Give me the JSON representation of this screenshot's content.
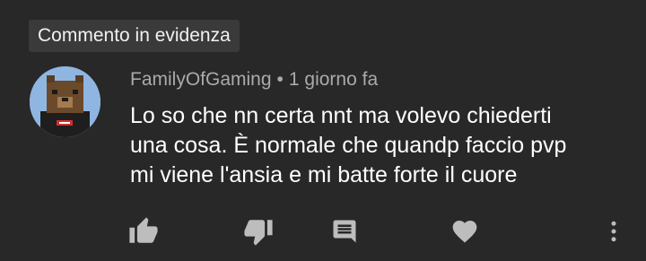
{
  "pinned_label": "Commento in evidenza",
  "comment": {
    "author": "FamilyOfGaming",
    "separator": "•",
    "time": "1 giorno fa",
    "text_lines": [
      "Lo so che nn certa nnt ma volevo chiederti",
      "una cosa. È normale che quandp faccio pvp",
      "mi viene l'ansia e mi batte forte il cuore"
    ]
  },
  "actions": [
    {
      "icon": "thumbs-up-icon"
    },
    {
      "icon": "thumbs-down-icon"
    },
    {
      "icon": "reply-icon"
    },
    {
      "icon": "heart-icon"
    },
    {
      "icon": "more-vert-icon"
    }
  ],
  "colors": {
    "background": "#282828",
    "badge_bg": "#3a3a3a",
    "text_primary": "#ffffff",
    "text_secondary": "#aaaaaa",
    "icon": "#bdbdbd",
    "avatar_bg": "#8fb6e0"
  }
}
